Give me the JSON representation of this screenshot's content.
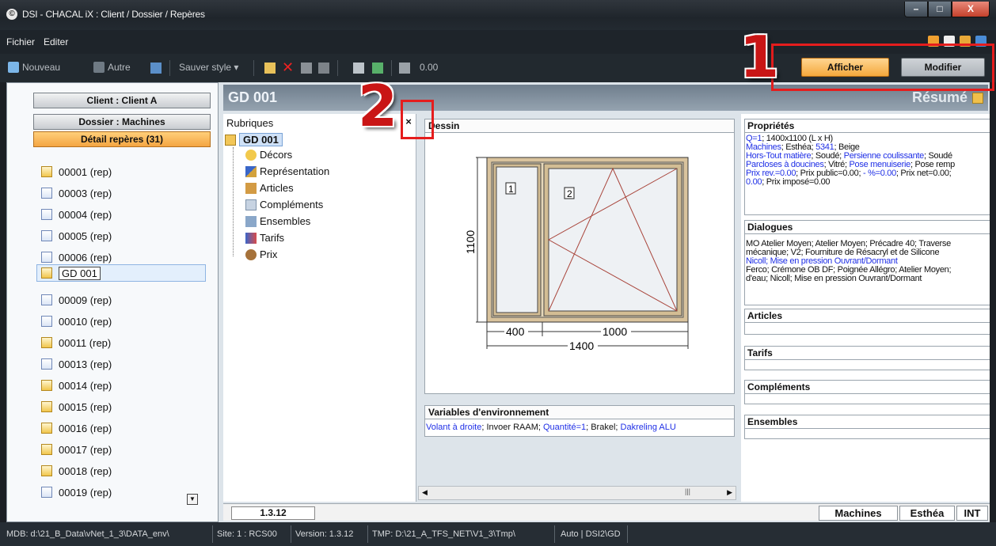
{
  "window": {
    "title": "DSI - CHACAL iX : Client / Dossier / Repères",
    "app_icon": "©",
    "min_label": "–",
    "max_label": "□",
    "close_label": "X"
  },
  "menu": {
    "fichier": "Fichier",
    "editer": "Editer"
  },
  "toolbar": {
    "nouveau": "Nouveau",
    "autre": "Autre",
    "sauver_style": "Sauver style ▾",
    "value": "0.00",
    "afficher": "Afficher",
    "modifier": "Modifier"
  },
  "left": {
    "client": "Client : Client A",
    "dossier": "Dossier : Machines",
    "detail": "Détail repères (31)",
    "items": [
      "00001 (rep)",
      "00003 (rep)",
      "00004 (rep)",
      "00005 (rep)",
      "00006 (rep)",
      "GD 001",
      "00009 (rep)",
      "00010 (rep)",
      "00011 (rep)",
      "00013 (rep)",
      "00014 (rep)",
      "00015 (rep)",
      "00016 (rep)",
      "00017 (rep)",
      "00018 (rep)",
      "00019 (rep)"
    ]
  },
  "main": {
    "title": "GD 001",
    "resume": "Résumé"
  },
  "rubriques": {
    "title": "Rubriques",
    "close": "×",
    "root": "GD 001",
    "items": [
      "Décors",
      "Représentation",
      "Articles",
      "Compléments",
      "Ensembles",
      "Tarifs",
      "Prix"
    ]
  },
  "dessin": {
    "title": "Dessin",
    "pane1": "1",
    "pane2": "2",
    "height": "1100",
    "w1": "400",
    "w2": "1000",
    "total": "1400"
  },
  "variables": {
    "title": "Variables d'environnement",
    "content": [
      {
        "text": "Volant à droite",
        "blue": true
      },
      {
        "text": "; Invoer RAAM; ",
        "blue": false
      },
      {
        "text": "Quantité=1",
        "blue": true
      },
      {
        "text": "; Brakel; ",
        "blue": false
      },
      {
        "text": "Dakreling ALU",
        "blue": true
      }
    ]
  },
  "proprietes": {
    "title": "Propriétés",
    "l1a": "Q=1",
    "l1b": "; 1400x1100 (L x H)",
    "l2a": "Machines",
    "l2b": "; Esthéa; ",
    "l2c": "5341",
    "l2d": "; Beige",
    "l3a": "Hors-Tout matière",
    "l3b": "; Soudé; ",
    "l3c": "Persienne coulissante",
    "l3d": "; Soudé",
    "l4a": "Parcloses à doucines",
    "l4b": "; Vitré; ",
    "l4c": "Pose menuiserie",
    "l4d": "; Pose remp",
    "l5a": "Prix rev.=0.00",
    "l5b": "; Prix public=0.00; ",
    "l5c": "- %=0.00",
    "l5d": "; Prix net=0.00;",
    "l6a": "0.00",
    "l6b": "; Prix imposé=0.00"
  },
  "dialogues": {
    "title": "Dialogues",
    "l1": "MO Atelier Moyen; Atelier Moyen; Précadre 40; Traverse",
    "l2": "mécanique; V2; Fourniture de Résacryl et de Silicone",
    "l3": "Nicoll; Mise en pression Ouvrant/Dormant",
    "l4": "Ferco; Crémone OB DF; Poignée Allégro; Atelier Moyen;",
    "l5": "d'eau; Nicoll; Mise en pression Ouvrant/Dormant"
  },
  "panels": {
    "articles": "Articles",
    "tarifs": "Tarifs",
    "complements": "Compléments",
    "ensembles": "Ensembles"
  },
  "status": {
    "version": "1.3.12",
    "machines": "Machines",
    "esthea": "Esthéa",
    "int": "INT"
  },
  "bottombar": {
    "mdb": "MDB: d:\\21_B_Data\\vNet_1_3\\DATA_env\\",
    "site": "Site: 1 : RCS00",
    "version": "Version: 1.3.12",
    "tmp": "TMP: D:\\21_A_TFS_NET\\V1_3\\Tmp\\",
    "auto": "Auto | DSI2\\GD"
  },
  "callouts": {
    "one": "1",
    "two": "2"
  },
  "colors": {
    "accent_orange": "#f4a83c",
    "callout_red": "#e51d1d",
    "link_blue": "#1f2fe6"
  }
}
